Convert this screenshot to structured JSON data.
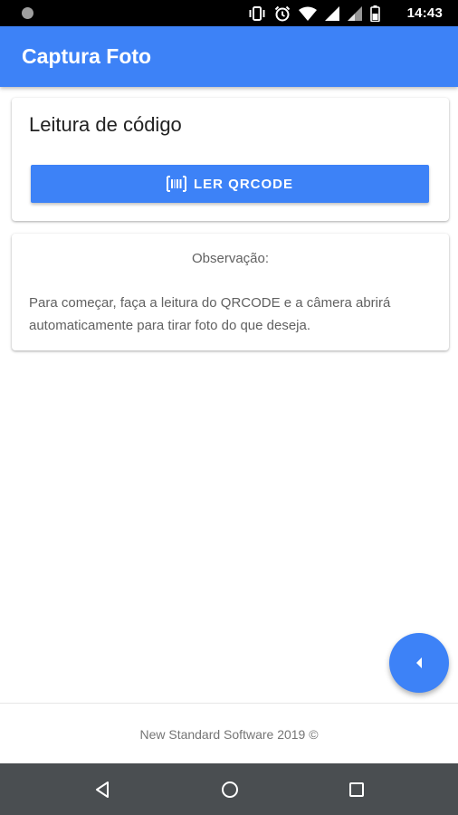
{
  "status_bar": {
    "time": "14:43",
    "icons": [
      "vibrate-icon",
      "alarm-icon",
      "wifi-icon",
      "signal-icon",
      "signal-icon",
      "battery-icon"
    ]
  },
  "app_bar": {
    "title": "Captura Foto"
  },
  "code_card": {
    "title": "Leitura de código",
    "button_label": "LER QRCODE",
    "button_icon": "barcode-icon"
  },
  "obs_card": {
    "title": "Observação:",
    "text": "Para começar, faça a leitura do QRCODE e a câmera abrirá automaticamente para tirar foto do que deseja."
  },
  "fab": {
    "icon": "caret-left-icon"
  },
  "footer": {
    "text": "New Standard Software 2019 ©"
  },
  "nav_bar": {
    "icons": [
      "back-icon",
      "home-icon",
      "recents-icon"
    ]
  },
  "colors": {
    "primary": "#3d82f7",
    "status_bar": "#000000",
    "nav_bar": "#4a4e51",
    "body_text": "#616161"
  }
}
